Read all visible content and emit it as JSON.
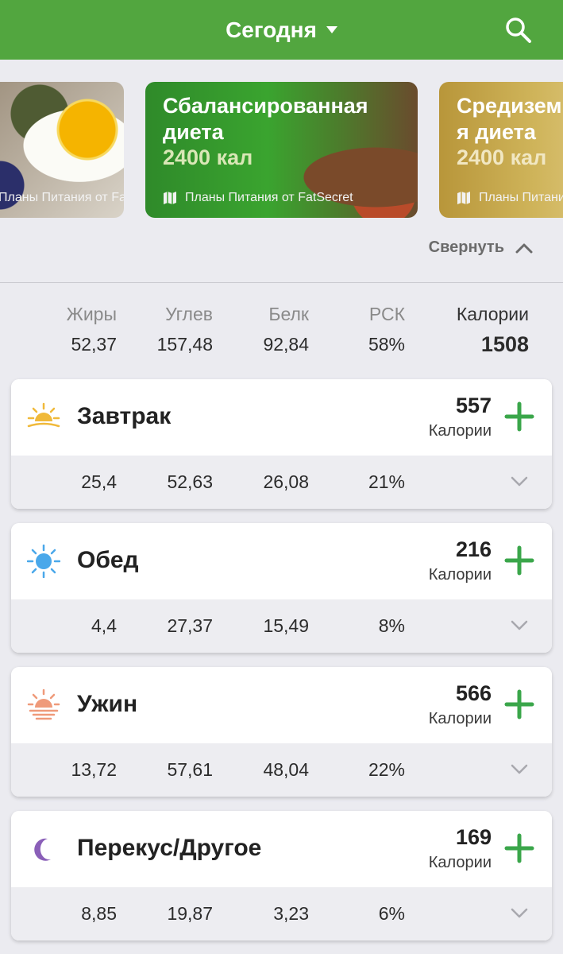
{
  "header": {
    "title": "Сегодня"
  },
  "carousel": [
    {
      "title": "",
      "kal": "",
      "footer": "Планы Питания от FatSecret"
    },
    {
      "title": "Сбалансированная\nдиета",
      "kal": "2400 кал",
      "footer": "Планы Питания от FatSecret"
    },
    {
      "title": "Средиземноморская\nя диета",
      "kal": "2400 кал",
      "footer": "Планы Питания от FatSecret"
    }
  ],
  "collapse_label": "Свернуть",
  "summary": {
    "fat": {
      "label": "Жиры",
      "value": "52,37"
    },
    "carbs": {
      "label": "Углев",
      "value": "157,48"
    },
    "protein": {
      "label": "Белк",
      "value": "92,84"
    },
    "rsk": {
      "label": "РСК",
      "value": "58%"
    },
    "calories": {
      "label": "Калории",
      "value": "1508"
    }
  },
  "meals": [
    {
      "name": "Завтрак",
      "calories": "557",
      "calories_label": "Калории",
      "fat": "25,4",
      "carbs": "52,63",
      "protein": "26,08",
      "rsk": "21%"
    },
    {
      "name": "Обед",
      "calories": "216",
      "calories_label": "Калории",
      "fat": "4,4",
      "carbs": "27,37",
      "protein": "15,49",
      "rsk": "8%"
    },
    {
      "name": "Ужин",
      "calories": "566",
      "calories_label": "Калории",
      "fat": "13,72",
      "carbs": "57,61",
      "protein": "48,04",
      "rsk": "22%"
    },
    {
      "name": "Перекус/Другое",
      "calories": "169",
      "calories_label": "Калории",
      "fat": "8,85",
      "carbs": "19,87",
      "protein": "3,23",
      "rsk": "6%"
    }
  ],
  "colors": {
    "brand": "#52a63f",
    "add": "#3aa64a",
    "snack_moon": "#8a5fb8",
    "lunch_sun": "#4aa8ea",
    "breakfast_sun": "#f0b93a",
    "dinner_sun": "#ef9a7a"
  },
  "icons": {
    "search": "search-icon",
    "add": "plus-icon",
    "expand": "chevron-down-icon",
    "collapse": "chevron-up-icon"
  }
}
